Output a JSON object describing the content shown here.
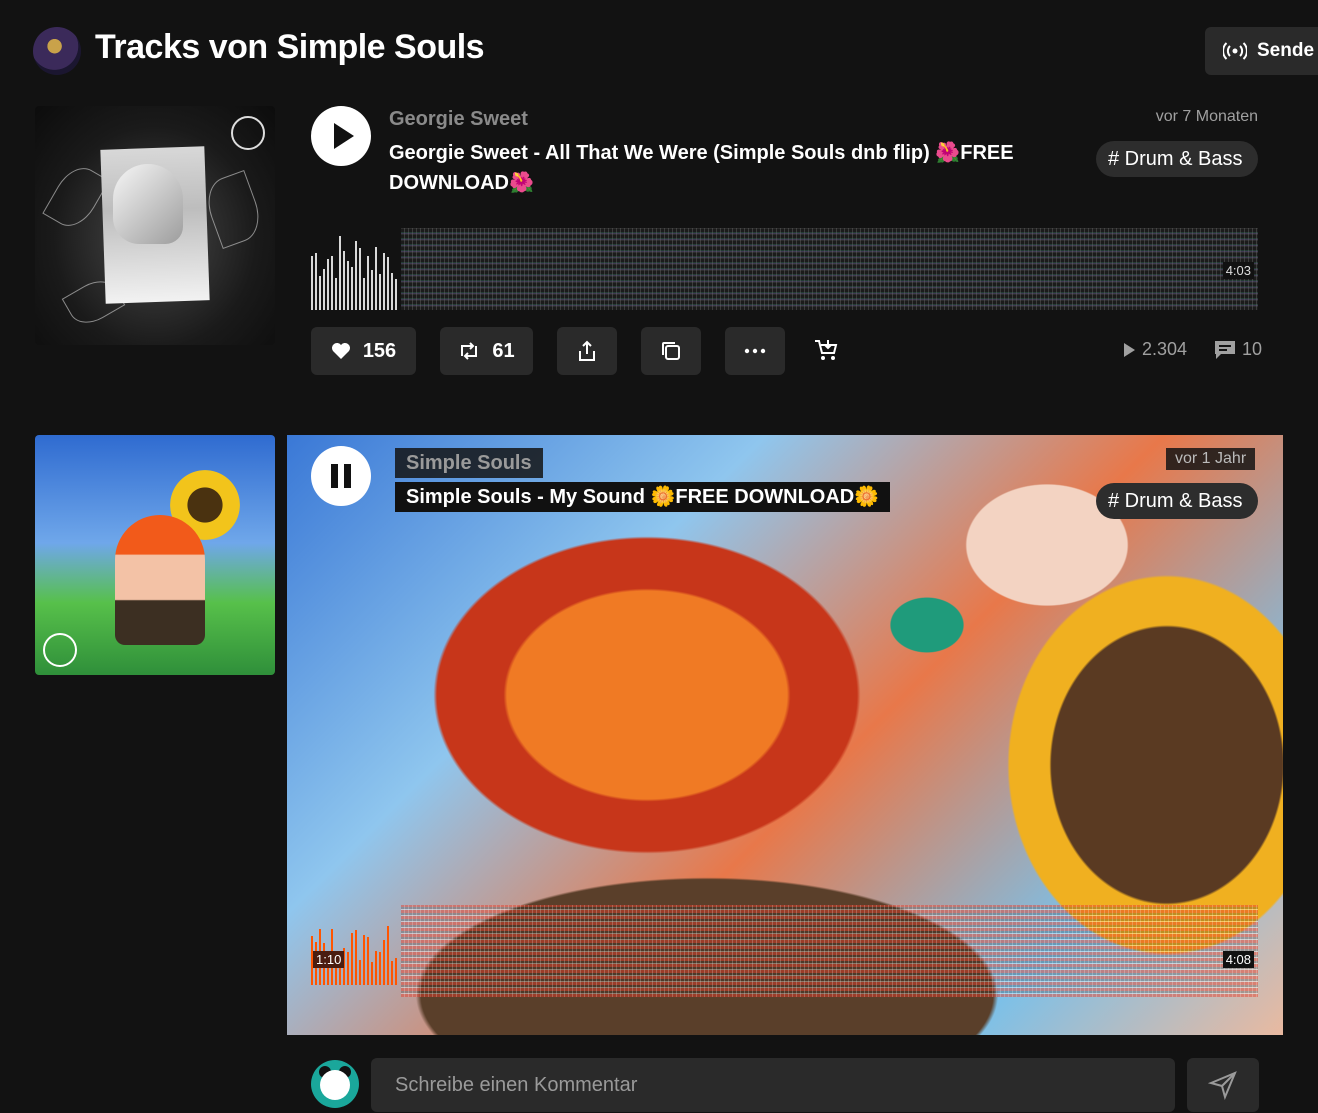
{
  "header": {
    "title": "Tracks von Simple Souls",
    "broadcast_label": "Sende"
  },
  "tracks": [
    {
      "artist": "Georgie Sweet",
      "title": "Georgie Sweet - All That We Were (Simple Souls dnb flip) 🌺FREE DOWNLOAD🌺",
      "date": "vor 7 Monaten",
      "tag": "# Drum & Bass",
      "duration": "4:03",
      "state": "stopped",
      "likes": "156",
      "reposts": "61",
      "plays": "2.304",
      "comments": "10"
    },
    {
      "artist": "Simple Souls",
      "title": "Simple Souls - My Sound 🌼FREE DOWNLOAD🌼",
      "date": "vor 1 Jahr",
      "tag": "# Drum & Bass",
      "duration": "4:08",
      "position": "1:10",
      "state": "playing"
    }
  ],
  "comment": {
    "placeholder": "Schreibe einen Kommentar"
  },
  "colors": {
    "background": "#121212",
    "surface": "#2a2a2a",
    "accent": "#ff5500"
  }
}
